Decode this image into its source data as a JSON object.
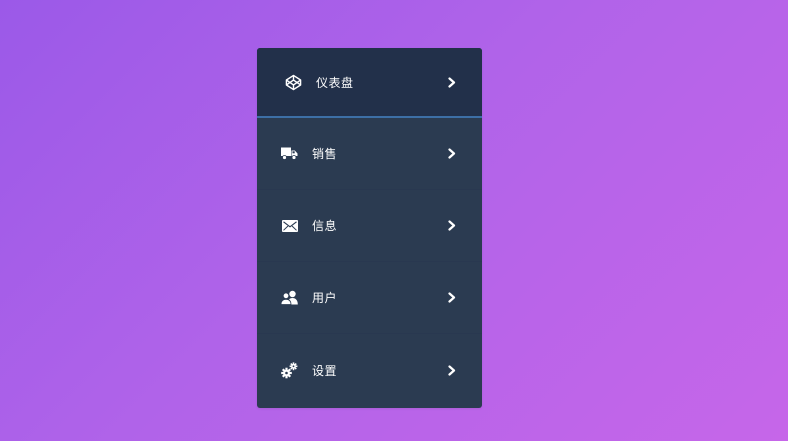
{
  "menu": {
    "items": [
      {
        "label": "仪表盘",
        "icon": "codepen-icon",
        "active": true
      },
      {
        "label": "销售",
        "icon": "truck-icon",
        "active": false
      },
      {
        "label": "信息",
        "icon": "envelope-icon",
        "active": false
      },
      {
        "label": "用户",
        "icon": "users-icon",
        "active": false
      },
      {
        "label": "设置",
        "icon": "gears-icon",
        "active": false
      }
    ]
  },
  "colors": {
    "panel": "#2b3b51",
    "active_item": "#22304a",
    "active_underline": "#3d6fa6",
    "text": "#ffffff"
  }
}
